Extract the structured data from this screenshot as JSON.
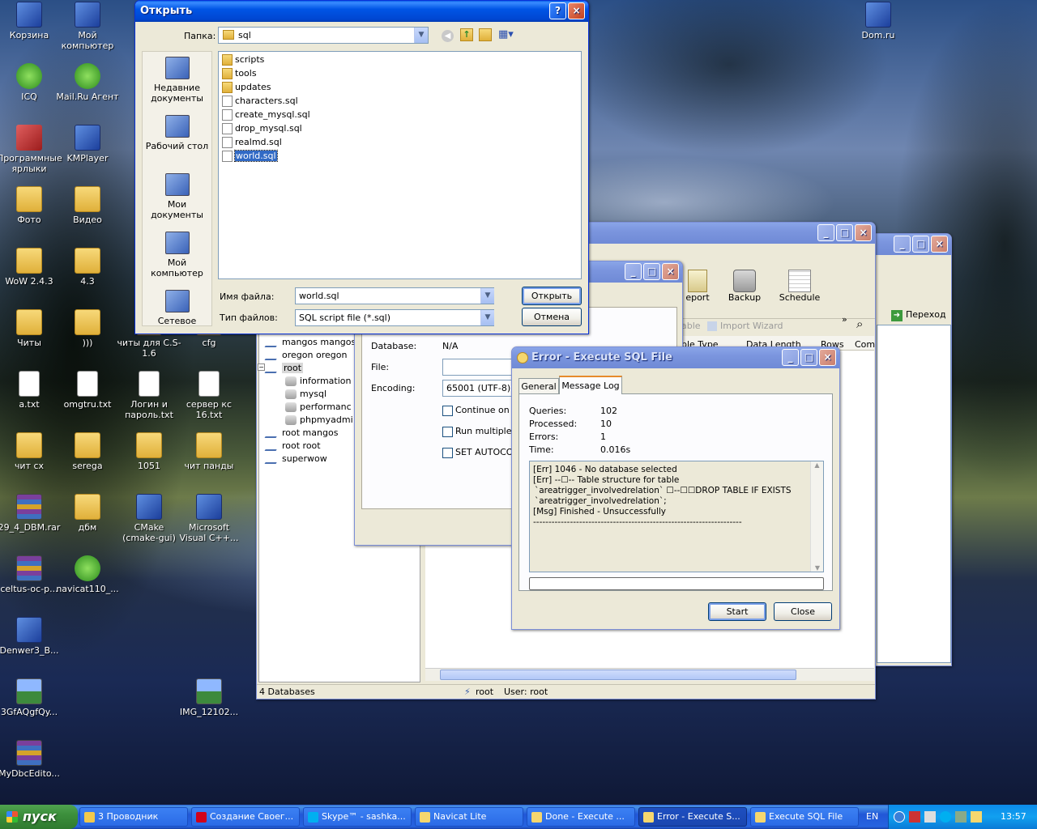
{
  "desktop": {
    "icons": [
      {
        "label": "Корзина",
        "kind": "app"
      },
      {
        "label": "Мой компьютер",
        "kind": "app"
      },
      {
        "label": "ICQ",
        "kind": "green"
      },
      {
        "label": "Mail.Ru Агент",
        "kind": "green"
      },
      {
        "label": "Программные ярлыки",
        "kind": "red"
      },
      {
        "label": "KMPlayer",
        "kind": "app"
      },
      {
        "label": "Фото",
        "kind": "folder"
      },
      {
        "label": "Видео",
        "kind": "folder"
      },
      {
        "label": "WoW 2.4.3",
        "kind": "folder"
      },
      {
        "label": "4.3",
        "kind": "folder"
      },
      {
        "label": "Читы",
        "kind": "folder"
      },
      {
        "label": ")))",
        "kind": "folder"
      },
      {
        "label": "читы для C.S-1.6",
        "kind": "folder"
      },
      {
        "label": "cfg",
        "kind": "folder"
      },
      {
        "label": "a.txt",
        "kind": "txt"
      },
      {
        "label": "omgtru.txt",
        "kind": "txt"
      },
      {
        "label": "Логин и пароль.txt",
        "kind": "txt"
      },
      {
        "label": "сервер кс 16.txt",
        "kind": "txt"
      },
      {
        "label": "чит сх",
        "kind": "folder"
      },
      {
        "label": "serega",
        "kind": "folder"
      },
      {
        "label": "1051",
        "kind": "folder"
      },
      {
        "label": "чит панды",
        "kind": "folder"
      },
      {
        "label": "29_4_DBM.rar",
        "kind": "rar"
      },
      {
        "label": "дбм",
        "kind": "folder"
      },
      {
        "label": "CMake (cmake-gui)",
        "kind": "app"
      },
      {
        "label": "Microsoft Visual C++...",
        "kind": "app"
      },
      {
        "label": "celtus-oc-p...",
        "kind": "rar"
      },
      {
        "label": "navicat110_...",
        "kind": "green"
      },
      {
        "label": "Denwer3_B...",
        "kind": "app"
      },
      {
        "label": "3GfAQgfQy...",
        "kind": "pic"
      },
      {
        "label": "IMG_12102...",
        "kind": "pic"
      },
      {
        "label": "MyDbcEdito...",
        "kind": "rar"
      },
      {
        "label": "Dom.ru",
        "kind": "app"
      }
    ]
  },
  "open_dialog": {
    "title": "Открыть",
    "folder_label": "Папка:",
    "folder_value": "sql",
    "places": [
      "Недавние документы",
      "Рабочий стол",
      "Мои документы",
      "Мой компьютер",
      "Сетевое"
    ],
    "files": [
      {
        "name": "scripts",
        "type": "folder"
      },
      {
        "name": "tools",
        "type": "folder"
      },
      {
        "name": "updates",
        "type": "folder"
      },
      {
        "name": "characters.sql",
        "type": "file"
      },
      {
        "name": "create_mysql.sql",
        "type": "file"
      },
      {
        "name": "drop_mysql.sql",
        "type": "file"
      },
      {
        "name": "realmd.sql",
        "type": "file"
      },
      {
        "name": "world.sql",
        "type": "file",
        "selected": true
      }
    ],
    "filename_label": "Имя файла:",
    "filename_value": "world.sql",
    "filetype_label": "Тип файлов:",
    "filetype_value": "SQL script file (*.sql)",
    "open_button": "Открыть",
    "cancel_button": "Отмена"
  },
  "navicat": {
    "toolbar": {
      "report": "eport",
      "backup": "Backup",
      "schedule": "Schedule"
    },
    "subtoolbar": {
      "table": "able",
      "import_wizard": "Import Wizard"
    },
    "columns": {
      "table_type": "ble Type",
      "data_length": "Data Length",
      "rows": "Rows",
      "comment": "Com"
    },
    "tree": [
      {
        "label": "mangos mangos",
        "level": 0
      },
      {
        "label": "oregon oregon",
        "level": 0
      },
      {
        "label": "root",
        "level": 0,
        "open": true
      },
      {
        "label": "information",
        "level": 1
      },
      {
        "label": "mysql",
        "level": 1
      },
      {
        "label": "performanc",
        "level": 1
      },
      {
        "label": "phpmyadmi",
        "level": 1
      },
      {
        "label": "root mangos",
        "level": 0
      },
      {
        "label": "root root",
        "level": 0
      },
      {
        "label": "superwow",
        "level": 0
      }
    ],
    "status": {
      "databases": "4 Databases",
      "conn": "root",
      "user": "User: root"
    }
  },
  "explorer_back": {
    "go_label": "Переход"
  },
  "execute_dialog": {
    "database_label": "Database:",
    "database_value": "N/A",
    "file_label": "File:",
    "encoding_label": "Encoding:",
    "encoding_value": "65001 (UTF-8)",
    "opt_continue": "Continue on er",
    "opt_multiple": "Run multiple q",
    "opt_autocommit": "SET AUTOCOM"
  },
  "error_dialog": {
    "title": "Error - Execute SQL File",
    "tabs": [
      "General",
      "Message Log"
    ],
    "stats": [
      {
        "label": "Queries:",
        "value": "102"
      },
      {
        "label": "Processed:",
        "value": "10"
      },
      {
        "label": "Errors:",
        "value": "1"
      },
      {
        "label": "Time:",
        "value": "0.016s"
      }
    ],
    "log": [
      "[Err] 1046 - No database selected",
      "[Err] --☐-- Table structure for table",
      "`areatrigger_involvedrelation` ☐--☐☐DROP TABLE IF EXISTS",
      "`areatrigger_involvedrelation`;",
      "[Msg] Finished - Unsuccessfully",
      "--------------------------------------------------------------------"
    ],
    "start_button": "Start",
    "close_button": "Close"
  },
  "taskbar": {
    "start_label": "пуск",
    "tasks": [
      {
        "label": "3 Проводник",
        "color": "#f2c94c"
      },
      {
        "label": "Создание Своег...",
        "color": "#d0021b"
      },
      {
        "label": "Skype™ - sashka...",
        "color": "#00aff0"
      },
      {
        "label": "Navicat Lite",
        "color": "#f5d76e"
      },
      {
        "label": "Done - Execute ...",
        "color": "#f5d76e"
      },
      {
        "label": "Error - Execute S...",
        "color": "#f5d76e"
      },
      {
        "label": "Execute SQL File",
        "color": "#f5d76e"
      }
    ],
    "lang": "EN",
    "clock": "13:57"
  }
}
